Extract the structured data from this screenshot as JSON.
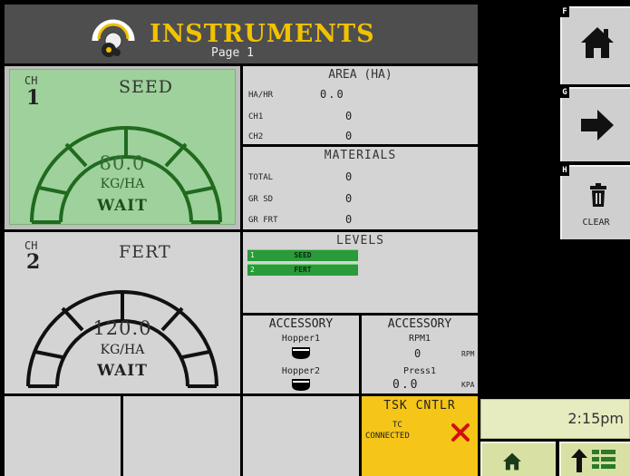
{
  "header": {
    "title": "INSTRUMENTS",
    "page": "Page 1",
    "logo_icon": "gauge-gear-icon"
  },
  "channels": [
    {
      "ch_label": "CH",
      "ch_number": "1",
      "name": "SEED",
      "value": "80.0",
      "unit": "KG/HA",
      "status": "WAIT",
      "highlighted": true
    },
    {
      "ch_label": "CH",
      "ch_number": "2",
      "name": "FERT",
      "value": "120.0",
      "unit": "KG/HA",
      "status": "WAIT",
      "highlighted": false
    }
  ],
  "area": {
    "title": "AREA  (HA)",
    "rows": [
      {
        "label": "HA/HR",
        "value": "0.0"
      },
      {
        "label": "CH1",
        "value": "0"
      },
      {
        "label": "CH2",
        "value": "0"
      }
    ]
  },
  "materials": {
    "title": "MATERIALS",
    "rows": [
      {
        "label": "TOTAL",
        "value": "0"
      },
      {
        "label": "GR SD",
        "value": "0"
      },
      {
        "label": "GR FRT",
        "value": "0"
      }
    ]
  },
  "levels": {
    "title": "LEVELS",
    "items": [
      {
        "index": "1",
        "label": "SEED"
      },
      {
        "index": "2",
        "label": "FERT"
      }
    ]
  },
  "accessory1": {
    "title": "ACCESSORY",
    "items": [
      {
        "label": "Hopper1"
      },
      {
        "label": "Hopper2"
      }
    ]
  },
  "accessory2": {
    "title": "ACCESSORY",
    "rpm_label": "RPM1",
    "rpm_value": "0",
    "rpm_unit": "RPM",
    "press_label": "Press1",
    "press_value": "0.0",
    "press_unit": "KPA"
  },
  "task_controller": {
    "title": "TSK CNTLR",
    "status_line1": "TC",
    "status_line2": "CONNECTED",
    "status_icon": "x-icon"
  },
  "softkeys": [
    {
      "key": "F",
      "icon": "home-icon",
      "label": ""
    },
    {
      "key": "G",
      "icon": "arrow-right-icon",
      "label": ""
    },
    {
      "key": "H",
      "icon": "trash-icon",
      "label": "CLEAR"
    }
  ],
  "clock": {
    "time": "2:15pm"
  },
  "bottom_buttons": [
    {
      "icon": "home-icon"
    },
    {
      "icon": "menu-up-icon"
    }
  ],
  "colors": {
    "header_bg": "#4e4e4e",
    "title": "#f2c100",
    "active_channel": "#9ed19b",
    "level_bar": "#2a9a3a",
    "task_bg": "#f5c518",
    "clock_bg": "#e6ecbf",
    "bottom_bg": "#d9e0a4"
  }
}
